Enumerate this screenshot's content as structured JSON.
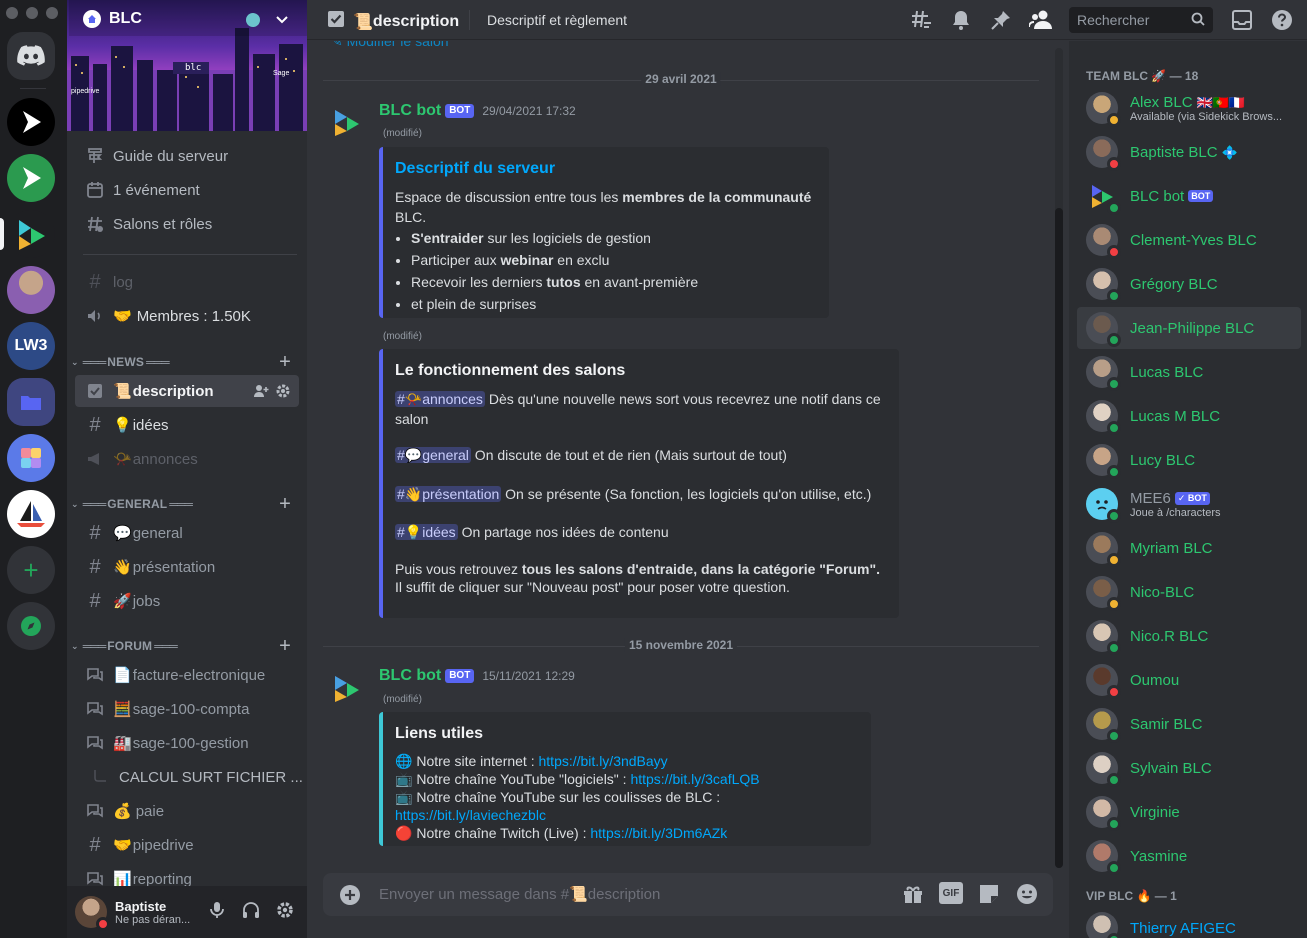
{
  "server": {
    "name": "BLC",
    "banner_labels": [
      "blc",
      "pipedrive",
      "Sage"
    ]
  },
  "rail": {
    "items": [
      "discord-home",
      "server-play-black",
      "server-play-green",
      "server-blc",
      "server-avatar",
      "LW3",
      "server-folder",
      "server-shortcut",
      "server-sail",
      "add-server",
      "explore"
    ]
  },
  "sidebar": {
    "top_items": [
      {
        "label": "Guide du serveur",
        "icon": "guide-icon"
      },
      {
        "label": "1 événement",
        "icon": "calendar-icon"
      },
      {
        "label": "Salons et rôles",
        "icon": "channels-roles-icon"
      }
    ],
    "pre_channels": [
      {
        "label": "log",
        "icon": "hash-icon",
        "emoji": ""
      },
      {
        "label": "Membres : 1.50K",
        "icon": "speaker-icon",
        "emoji": "🤝"
      }
    ],
    "categories": [
      {
        "name": "NEWS",
        "channels": [
          {
            "label": "description",
            "emoji": "📜",
            "icon": "rules-icon"
          },
          {
            "label": "idées",
            "emoji": "💡",
            "icon": "hash-icon"
          },
          {
            "label": "annonces",
            "emoji": "📯",
            "icon": "announcement-icon"
          }
        ]
      },
      {
        "name": "GENERAL",
        "channels": [
          {
            "label": "general",
            "emoji": "💬",
            "icon": "hash-icon"
          },
          {
            "label": "présentation",
            "emoji": "👋",
            "icon": "hash-icon"
          },
          {
            "label": "jobs",
            "emoji": "🚀",
            "icon": "hash-icon"
          }
        ]
      },
      {
        "name": "FORUM",
        "channels": [
          {
            "label": "facture-electronique",
            "emoji": "📄",
            "icon": "forum-icon"
          },
          {
            "label": "sage-100-compta",
            "emoji": "🧮",
            "icon": "forum-icon"
          },
          {
            "label": "sage-100-gestion",
            "emoji": "🏭",
            "icon": "forum-icon"
          },
          {
            "label": "CALCUL SURT FICHIER ...",
            "emoji": "",
            "icon": "thread-icon"
          },
          {
            "label": "paie",
            "emoji": "💰",
            "icon": "forum-icon"
          },
          {
            "label": "pipedrive",
            "emoji": "🤝",
            "icon": "hash-icon"
          },
          {
            "label": "reporting",
            "emoji": "📊",
            "icon": "forum-icon"
          }
        ]
      }
    ],
    "user": {
      "name": "Baptiste",
      "status": "Ne pas déran..."
    }
  },
  "header": {
    "channel_emoji": "📜",
    "channel": "description",
    "topic": "Descriptif et règlement",
    "search_placeholder": "Rechercher",
    "scrolled_text": "Modifier le salon"
  },
  "messages": [
    {
      "date_divider": "29 avril 2021",
      "author": "BLC bot",
      "badge": "BOT",
      "time": "29/04/2021 17:32",
      "edited": "(modifié)",
      "embed1": {
        "title": "Descriptif du serveur",
        "intro_a": "Espace de discussion entre tous les ",
        "intro_b": "membres de la communauté",
        "intro_c": " BLC.",
        "bullets": [
          {
            "b": "S'entraider",
            "t": " sur les logiciels de gestion"
          },
          {
            "b": "",
            "t": "Participer aux ",
            "b2": "webinar",
            "t2": " en exclu"
          },
          {
            "b": "",
            "t": "Recevoir les derniers ",
            "b2": "tutos",
            "t2": " en avant-première"
          },
          {
            "b": "",
            "t": "et plein de surprises"
          }
        ]
      },
      "edited2": "(modifié)",
      "embed2": {
        "title": "Le fonctionnement des salons",
        "lines": [
          {
            "mention": "#📯annonces",
            "text": " Dès qu'une nouvelle news sort vous recevrez une notif dans ce salon"
          },
          {
            "mention": "#💬general",
            "text": " On discute de tout et de rien (Mais surtout de tout)"
          },
          {
            "mention": "#👋présentation",
            "text": " On se présente (Sa fonction, les logiciels qu'on utilise, etc.)"
          },
          {
            "mention": "#💡idées",
            "text": " On partage nos idées de contenu"
          }
        ],
        "footer_a": "Puis vous retrouvez ",
        "footer_b": "tous les salons d'entraide, dans la catégorie \"Forum\".",
        "footer_c": "Il suffit de cliquer sur \"Nouveau post\" pour poser votre question."
      }
    },
    {
      "date_divider": "15 novembre 2021",
      "author": "BLC bot",
      "badge": "BOT",
      "time": "15/11/2021 12:29",
      "edited": "(modifié)",
      "embed": {
        "title": "Liens utiles",
        "links": [
          {
            "emoji": "🌐",
            "text": "Notre site internet : ",
            "url": "https://bit.ly/3ndBayy"
          },
          {
            "emoji": "📺",
            "text": "Notre chaîne YouTube \"logiciels\" : ",
            "url": "https://bit.ly/3cafLQB"
          },
          {
            "emoji": "📺",
            "text": "Notre chaîne YouTube sur les coulisses de BLC : ",
            "url": "https://bit.ly/laviechezblc"
          },
          {
            "emoji": "🔴",
            "text": "Notre chaîne Twitch (Live) : ",
            "url": "https://bit.ly/3Dm6AZk"
          }
        ]
      }
    }
  ],
  "composer": {
    "placeholder": "Envoyer un message dans #📜description",
    "gif": "GIF"
  },
  "members": {
    "groups": [
      {
        "title": "TEAM BLC 🚀 — 18",
        "items": [
          {
            "name": "Alex BLC",
            "suffix": "🇬🇧🇵🇹🇫🇷",
            "sub": "Available (via Sidekick Brows...",
            "status": "idle",
            "color": "#c9a678"
          },
          {
            "name": "Baptiste BLC",
            "suffix": "💠",
            "sub": "",
            "status": "dnd",
            "color": "#8a6b5a"
          },
          {
            "name": "BLC bot",
            "suffix": "",
            "badge": "BOT",
            "sub": "",
            "status": "on",
            "color": "bot"
          },
          {
            "name": "Clement-Yves BLC",
            "suffix": "",
            "sub": "",
            "status": "dnd",
            "color": "#a98a74"
          },
          {
            "name": "Grégory BLC",
            "suffix": "",
            "sub": "",
            "status": "on",
            "color": "#d6c0ad"
          },
          {
            "name": "Jean-Philippe BLC",
            "suffix": "",
            "sub": "",
            "status": "on",
            "color": "#6b5a4e"
          },
          {
            "name": "Lucas BLC",
            "suffix": "",
            "sub": "",
            "status": "on",
            "color": "#b89e88"
          },
          {
            "name": "Lucas M BLC",
            "suffix": "",
            "sub": "",
            "status": "on",
            "color": "#e0d2c4"
          },
          {
            "name": "Lucy BLC",
            "suffix": "",
            "sub": "",
            "status": "on",
            "color": "#c7a487"
          },
          {
            "name": "MEE6",
            "suffix": "",
            "badge": "✓ BOT",
            "sub": "Joue à /characters",
            "status": "on",
            "color": "mee6"
          },
          {
            "name": "Myriam BLC",
            "suffix": "",
            "sub": "",
            "status": "idle",
            "color": "#9b7a5c"
          },
          {
            "name": "Nico-BLC",
            "suffix": "",
            "sub": "",
            "status": "idle",
            "color": "#7a5e48"
          },
          {
            "name": "Nico.R BLC",
            "suffix": "",
            "sub": "",
            "status": "on",
            "color": "#d8c6b4"
          },
          {
            "name": "Oumou",
            "suffix": "",
            "sub": "",
            "status": "dnd",
            "color": "#5a3a2c"
          },
          {
            "name": "Samir BLC",
            "suffix": "",
            "sub": "",
            "status": "on",
            "color": "#b59a4c"
          },
          {
            "name": "Sylvain BLC",
            "suffix": "",
            "sub": "",
            "status": "on",
            "color": "#ddd0c4"
          },
          {
            "name": "Virginie",
            "suffix": "",
            "sub": "",
            "status": "on",
            "color": "#d2b9a6"
          },
          {
            "name": "Yasmine",
            "suffix": "",
            "sub": "",
            "status": "on",
            "color": "#b07a6a"
          }
        ]
      },
      {
        "title": "VIP BLC 🔥 — 1",
        "items": [
          {
            "name": "Thierry AFIGEC",
            "suffix": "",
            "sub": "",
            "status": "on",
            "color": "#cfc0b2"
          }
        ]
      }
    ]
  },
  "colors": {
    "accent": "#5865f2",
    "online": "#23a55a",
    "dnd": "#f23f43",
    "idle": "#f0b232",
    "member_name": "#2dc770",
    "link": "#00a8fc"
  }
}
